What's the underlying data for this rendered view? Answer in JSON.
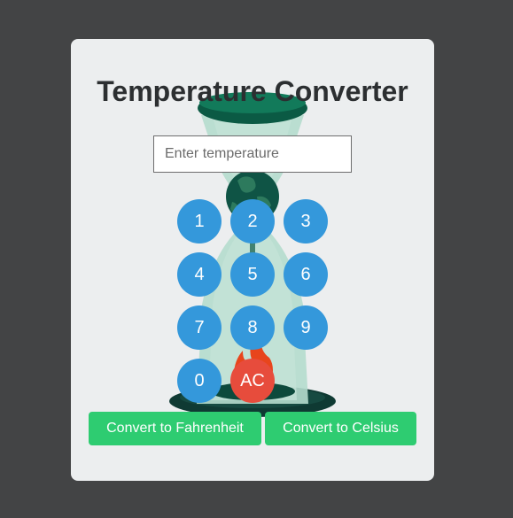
{
  "title": "Temperature Converter",
  "input": {
    "placeholder": "Enter temperature",
    "value": ""
  },
  "keypad": {
    "k1": "1",
    "k2": "2",
    "k3": "3",
    "k4": "4",
    "k5": "5",
    "k6": "6",
    "k7": "7",
    "k8": "8",
    "k9": "9",
    "k0": "0",
    "clear": "AC"
  },
  "buttons": {
    "to_fahrenheit": "Convert to Fahrenheit",
    "to_celsius": "Convert to Celsius"
  },
  "colors": {
    "keypad_blue": "#3498db",
    "clear_red": "#e74c3c",
    "convert_green": "#2ecc71",
    "background": "#434445",
    "card": "#eceeef"
  },
  "icons": [
    "hourglass-earth-illustration"
  ]
}
